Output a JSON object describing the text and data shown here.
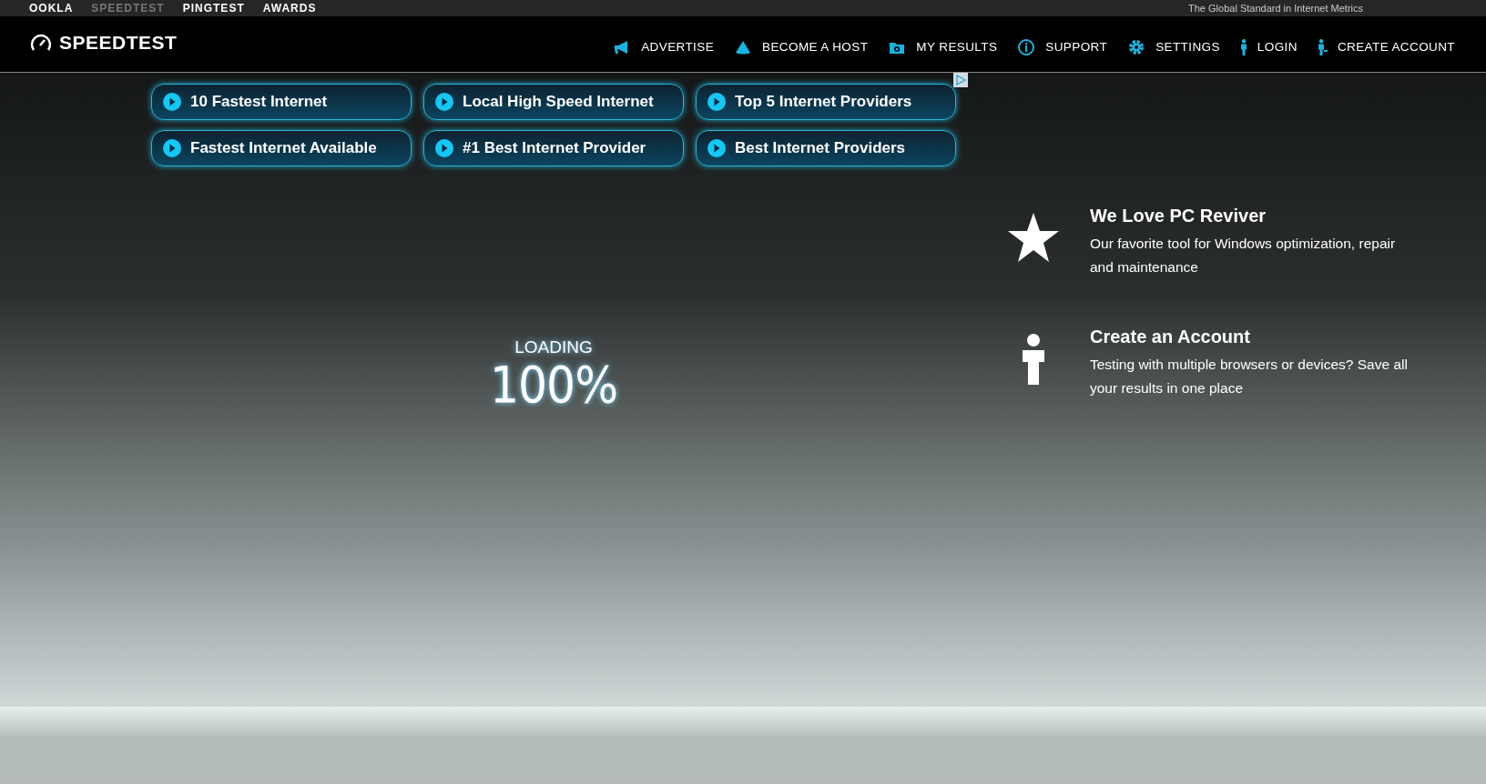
{
  "top_strip": {
    "links": [
      {
        "label": "OOKLA",
        "selected": false
      },
      {
        "label": "SPEEDTEST",
        "selected": true
      },
      {
        "label": "PINGTEST",
        "selected": false
      },
      {
        "label": "AWARDS",
        "selected": false
      }
    ],
    "tagline": "The Global Standard in Internet Metrics"
  },
  "header": {
    "logo": "SPEEDTEST",
    "nav": [
      {
        "label": "ADVERTISE",
        "kind": "megaphone"
      },
      {
        "label": "BECOME A HOST",
        "kind": "host"
      },
      {
        "label": "MY RESULTS",
        "kind": "results"
      },
      {
        "label": "SUPPORT",
        "kind": "info"
      },
      {
        "label": "SETTINGS",
        "kind": "gear"
      },
      {
        "label": "LOGIN",
        "kind": "person"
      },
      {
        "label": "CREATE ACCOUNT",
        "kind": "person-add"
      }
    ]
  },
  "ad_links": [
    "10 Fastest Internet",
    "Local High Speed Internet",
    "Top 5 Internet Providers",
    "Fastest Internet Available",
    "#1 Best Internet Provider",
    "Best Internet Providers"
  ],
  "loading": {
    "label": "LOADING",
    "value": "100%"
  },
  "promos": [
    {
      "kind": "star",
      "title": "We Love PC Reviver",
      "text": "Our favorite tool for Windows optimization, repair and maintenance"
    },
    {
      "kind": "person",
      "title": "Create an Account",
      "text": "Testing with multiple browsers or devices? Save all your results in one place"
    }
  ]
}
